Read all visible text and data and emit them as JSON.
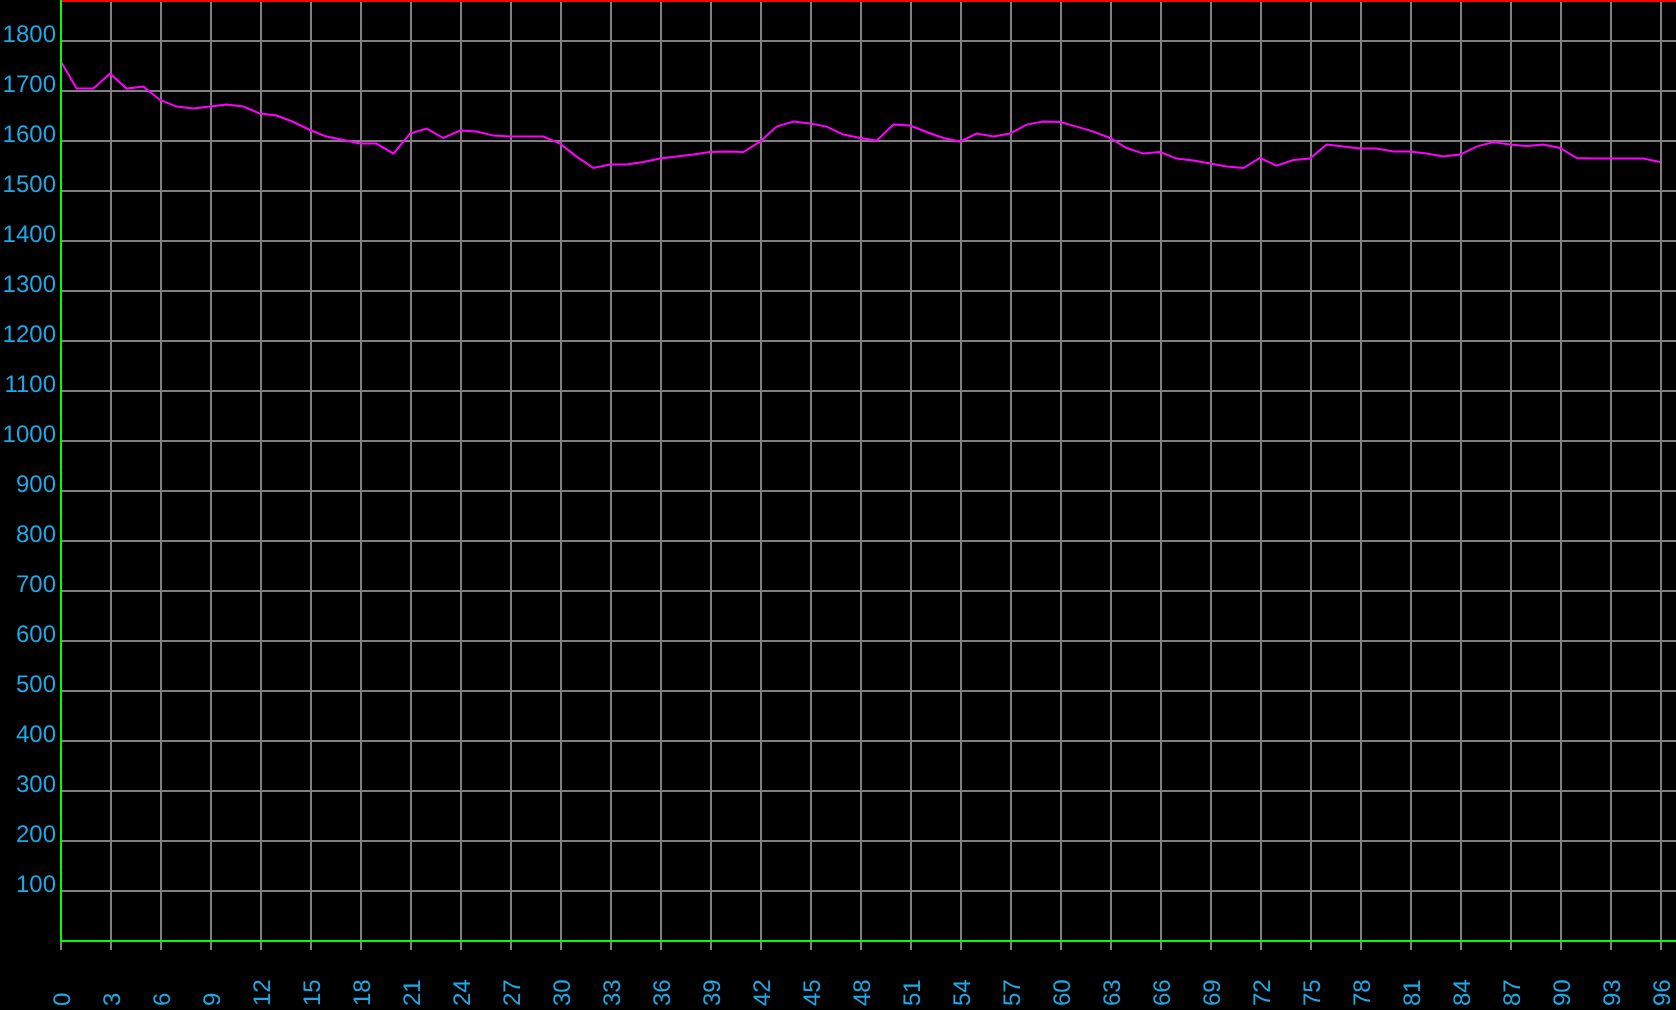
{
  "chart_data": {
    "type": "line",
    "grid": true,
    "x": [
      0,
      1,
      2,
      3,
      4,
      5,
      6,
      7,
      8,
      9,
      10,
      11,
      12,
      13,
      14,
      15,
      16,
      17,
      18,
      19,
      20,
      21,
      22,
      23,
      24,
      25,
      26,
      27,
      28,
      29,
      30,
      31,
      32,
      33,
      34,
      35,
      36,
      37,
      38,
      39,
      40,
      41,
      42,
      43,
      44,
      45,
      46,
      47,
      48,
      49,
      50,
      51,
      52,
      53,
      54,
      55,
      56,
      57,
      58,
      59,
      60,
      61,
      62,
      63,
      64,
      65,
      66,
      67,
      68,
      69,
      70,
      71,
      72,
      73,
      74,
      75,
      76,
      77,
      78,
      79,
      80,
      81,
      82,
      83,
      84,
      85,
      86,
      87,
      88,
      89,
      90,
      91,
      92,
      93,
      94,
      95,
      96
    ],
    "series": [
      {
        "color": "#ff00ff",
        "values": [
          1760,
          1703,
          1703,
          1733,
          1703,
          1707,
          1680,
          1667,
          1663,
          1667,
          1671,
          1667,
          1653,
          1649,
          1636,
          1620,
          1607,
          1600,
          1593,
          1593,
          1573,
          1613,
          1623,
          1604,
          1619,
          1617,
          1609,
          1607,
          1607,
          1607,
          1593,
          1567,
          1544,
          1551,
          1551,
          1556,
          1563,
          1567,
          1571,
          1576,
          1577,
          1576,
          1597,
          1627,
          1637,
          1633,
          1627,
          1611,
          1604,
          1599,
          1631,
          1629,
          1616,
          1604,
          1597,
          1613,
          1607,
          1613,
          1631,
          1637,
          1636,
          1627,
          1617,
          1604,
          1584,
          1573,
          1576,
          1563,
          1559,
          1553,
          1547,
          1544,
          1564,
          1549,
          1560,
          1563,
          1591,
          1587,
          1583,
          1583,
          1577,
          1577,
          1573,
          1567,
          1571,
          1587,
          1596,
          1591,
          1588,
          1591,
          1584,
          1564,
          1563,
          1563,
          1563,
          1563,
          1556
        ]
      }
    ],
    "xlim": [
      0,
      96.84
    ],
    "ylim": [
      0,
      1880
    ],
    "xticks": [
      0,
      3,
      6,
      9,
      12,
      15,
      18,
      21,
      24,
      27,
      30,
      33,
      36,
      39,
      42,
      45,
      48,
      51,
      54,
      57,
      60,
      63,
      66,
      69,
      72,
      75,
      78,
      81,
      84,
      87,
      90,
      93,
      96
    ],
    "yticks": [
      100,
      200,
      300,
      400,
      500,
      600,
      700,
      800,
      900,
      1000,
      1100,
      1200,
      1300,
      1400,
      1500,
      1600,
      1700,
      1800
    ]
  }
}
